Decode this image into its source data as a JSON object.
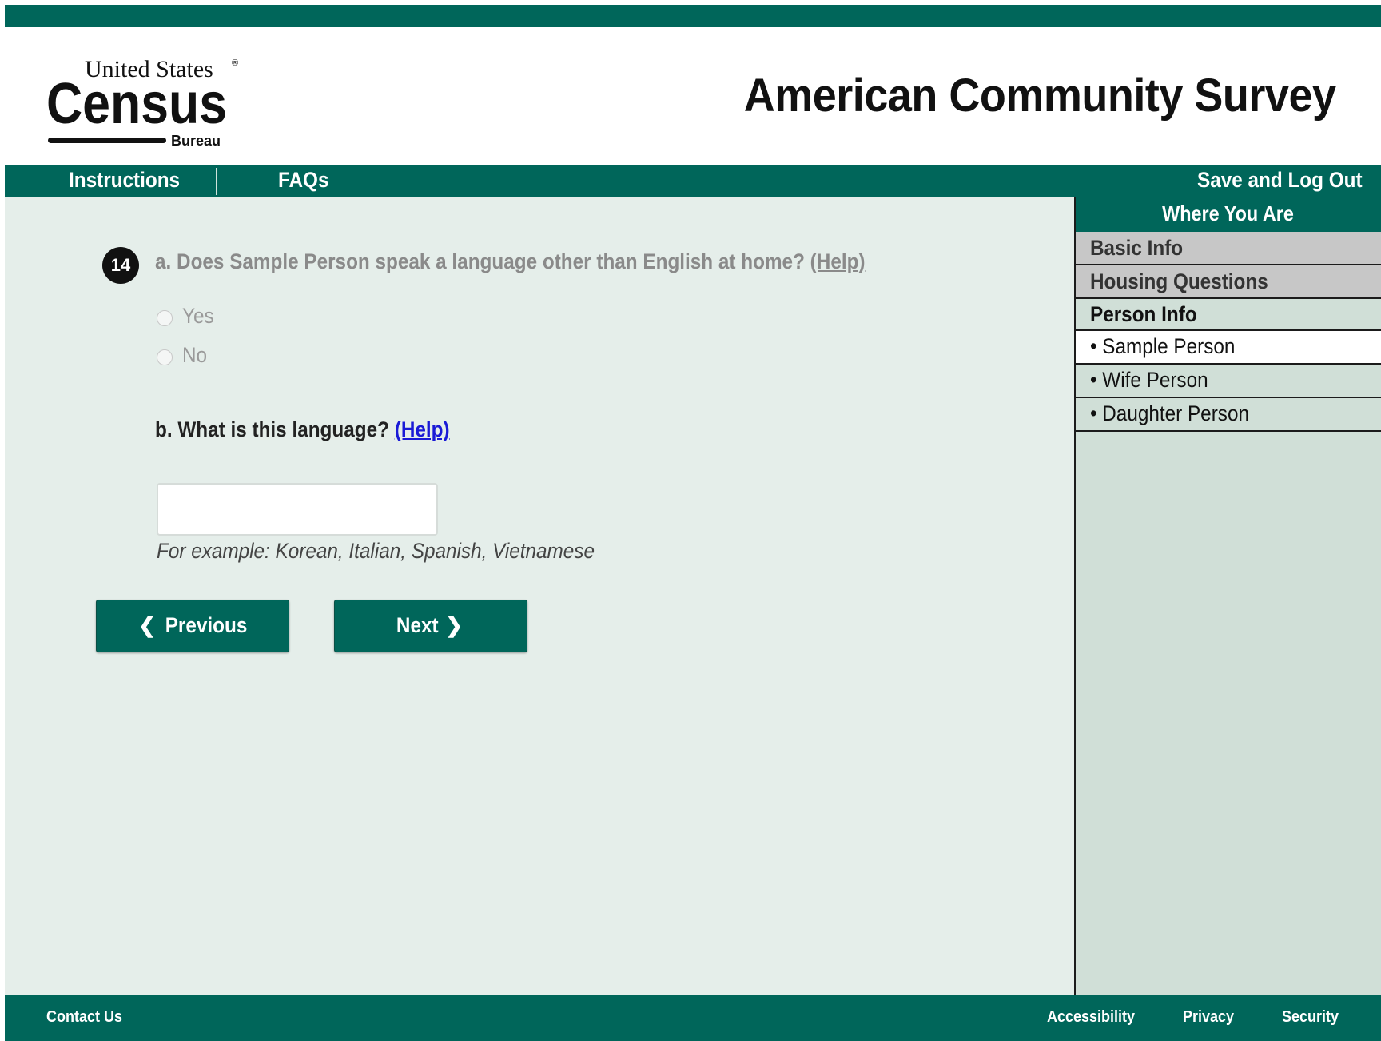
{
  "header": {
    "logo": {
      "line1": "United States",
      "registered_mark": "®",
      "word": "Census",
      "line3": "Bureau"
    },
    "title": "American Community Survey"
  },
  "nav": {
    "instructions": "Instructions",
    "faqs": "FAQs",
    "save_logout": "Save and Log Out"
  },
  "question": {
    "number": "14",
    "part_a": "a. Does Sample Person speak a language other than English at home?",
    "part_a_help": "(Help)",
    "options": [
      {
        "label": "Yes",
        "selected": false
      },
      {
        "label": "No",
        "selected": false
      }
    ],
    "part_b": "b. What is this language?",
    "part_b_help": "(Help)",
    "language_value": "",
    "example": "For example: Korean, Italian, Spanish, Vietnamese"
  },
  "buttons": {
    "previous": "Previous",
    "next": "Next",
    "previous_icon": "chevron-left-icon",
    "next_icon": "chevron-right-icon"
  },
  "sidebar": {
    "title": "Where You Are",
    "items": [
      {
        "label": "Basic Info",
        "state": "done"
      },
      {
        "label": "Housing Questions",
        "state": "done"
      },
      {
        "label": "Person Info",
        "state": "section"
      },
      {
        "label": "• Sample Person",
        "state": "current"
      },
      {
        "label": "• Wife Person",
        "state": "pending"
      },
      {
        "label": "• Daughter Person",
        "state": "pending"
      }
    ]
  },
  "footer": {
    "contact": "Contact Us",
    "accessibility": "Accessibility",
    "privacy": "Privacy",
    "security": "Security"
  },
  "colors": {
    "brand_green": "#00665a",
    "main_bg": "#e5eeea",
    "sidebar_bg": "#d0dfd7",
    "help_link": "#1a1ad6"
  }
}
